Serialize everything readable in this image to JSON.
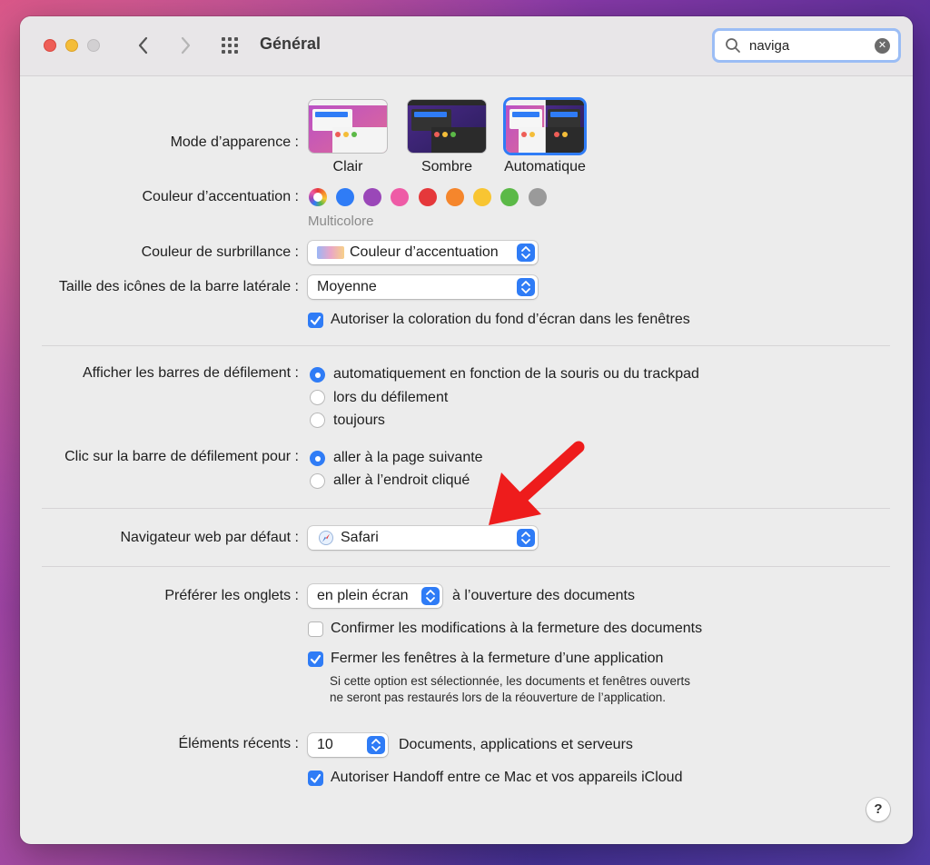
{
  "window": {
    "title": "Général"
  },
  "search": {
    "value": "naviga",
    "clear_symbol": "✕"
  },
  "appearance": {
    "label": "Mode d’apparence :",
    "options": [
      "Clair",
      "Sombre",
      "Automatique"
    ],
    "selected": "Automatique"
  },
  "accent": {
    "label": "Couleur d’accentuation :",
    "selected_name": "Multicolore",
    "colors": [
      "#2f7cf6",
      "#9a47b8",
      "#ee5ba6",
      "#e5383b",
      "#f5862c",
      "#f8c532",
      "#5bb947",
      "#9a9a9a"
    ]
  },
  "highlight": {
    "label": "Couleur de surbrillance :",
    "value": "Couleur d’accentuation"
  },
  "sidebar_icons": {
    "label": "Taille des icônes de la barre latérale :",
    "value": "Moyenne"
  },
  "wallpaper_tint": {
    "label": "Autoriser la coloration du fond d’écran dans les fenêtres",
    "checked": true
  },
  "scrollbars": {
    "label": "Afficher les barres de défilement :",
    "options": [
      "automatiquement en fonction de la souris ou du trackpad",
      "lors du défilement",
      "toujours"
    ],
    "selected_index": 0
  },
  "scroll_click": {
    "label": "Clic sur la barre de défilement pour :",
    "options": [
      "aller à la page suivante",
      "aller à l’endroit cliqué"
    ],
    "selected_index": 0
  },
  "browser": {
    "label": "Navigateur web par défaut :",
    "value": "Safari"
  },
  "tabs": {
    "label": "Préférer les onglets :",
    "value": "en plein écran",
    "suffix": "à l’ouverture des documents"
  },
  "confirm_changes": {
    "label": "Confirmer les modifications à la fermeture des documents",
    "checked": false
  },
  "close_windows": {
    "label": "Fermer les fenêtres à la fermeture d’une application",
    "checked": true,
    "note": "Si cette option est sélectionnée, les documents et fenêtres ouverts ne seront pas restaurés lors de la réouverture de l’application."
  },
  "recents": {
    "label": "Éléments récents :",
    "value": "10",
    "suffix": "Documents, applications et serveurs"
  },
  "handoff": {
    "label": "Autoriser Handoff entre ce Mac et vos appareils iCloud",
    "checked": true
  },
  "help": {
    "label": "?"
  },
  "accent_color": "#2f7cf6",
  "annotation_color": "#ee1c1c"
}
